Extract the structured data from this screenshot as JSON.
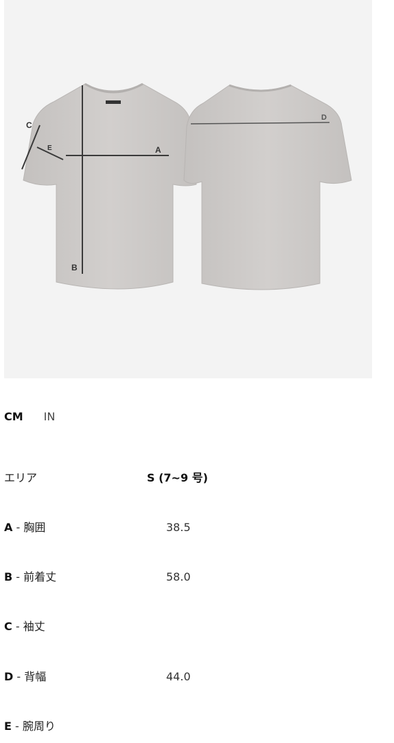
{
  "units": {
    "active": "CM",
    "inactive": "IN"
  },
  "image": {
    "label_a": "A",
    "label_b": "B",
    "label_c": "C",
    "label_d": "D",
    "label_e": "E"
  },
  "table": {
    "header_area": "エリア",
    "header_size": "S (7~9 号)",
    "separator": " - ",
    "rows": [
      {
        "letter": "A",
        "name": "胸囲",
        "value": "38.5"
      },
      {
        "letter": "B",
        "name": "前着丈",
        "value": "58.0"
      },
      {
        "letter": "C",
        "name": "袖丈",
        "value": ""
      },
      {
        "letter": "D",
        "name": "背幅",
        "value": "44.0"
      },
      {
        "letter": "E",
        "name": "腕周り",
        "value": ""
      }
    ]
  },
  "colors": {
    "panel_bg": "#f3f3f3",
    "tshirt": "#cdcac8",
    "measure_line": "#3a3a3a"
  }
}
